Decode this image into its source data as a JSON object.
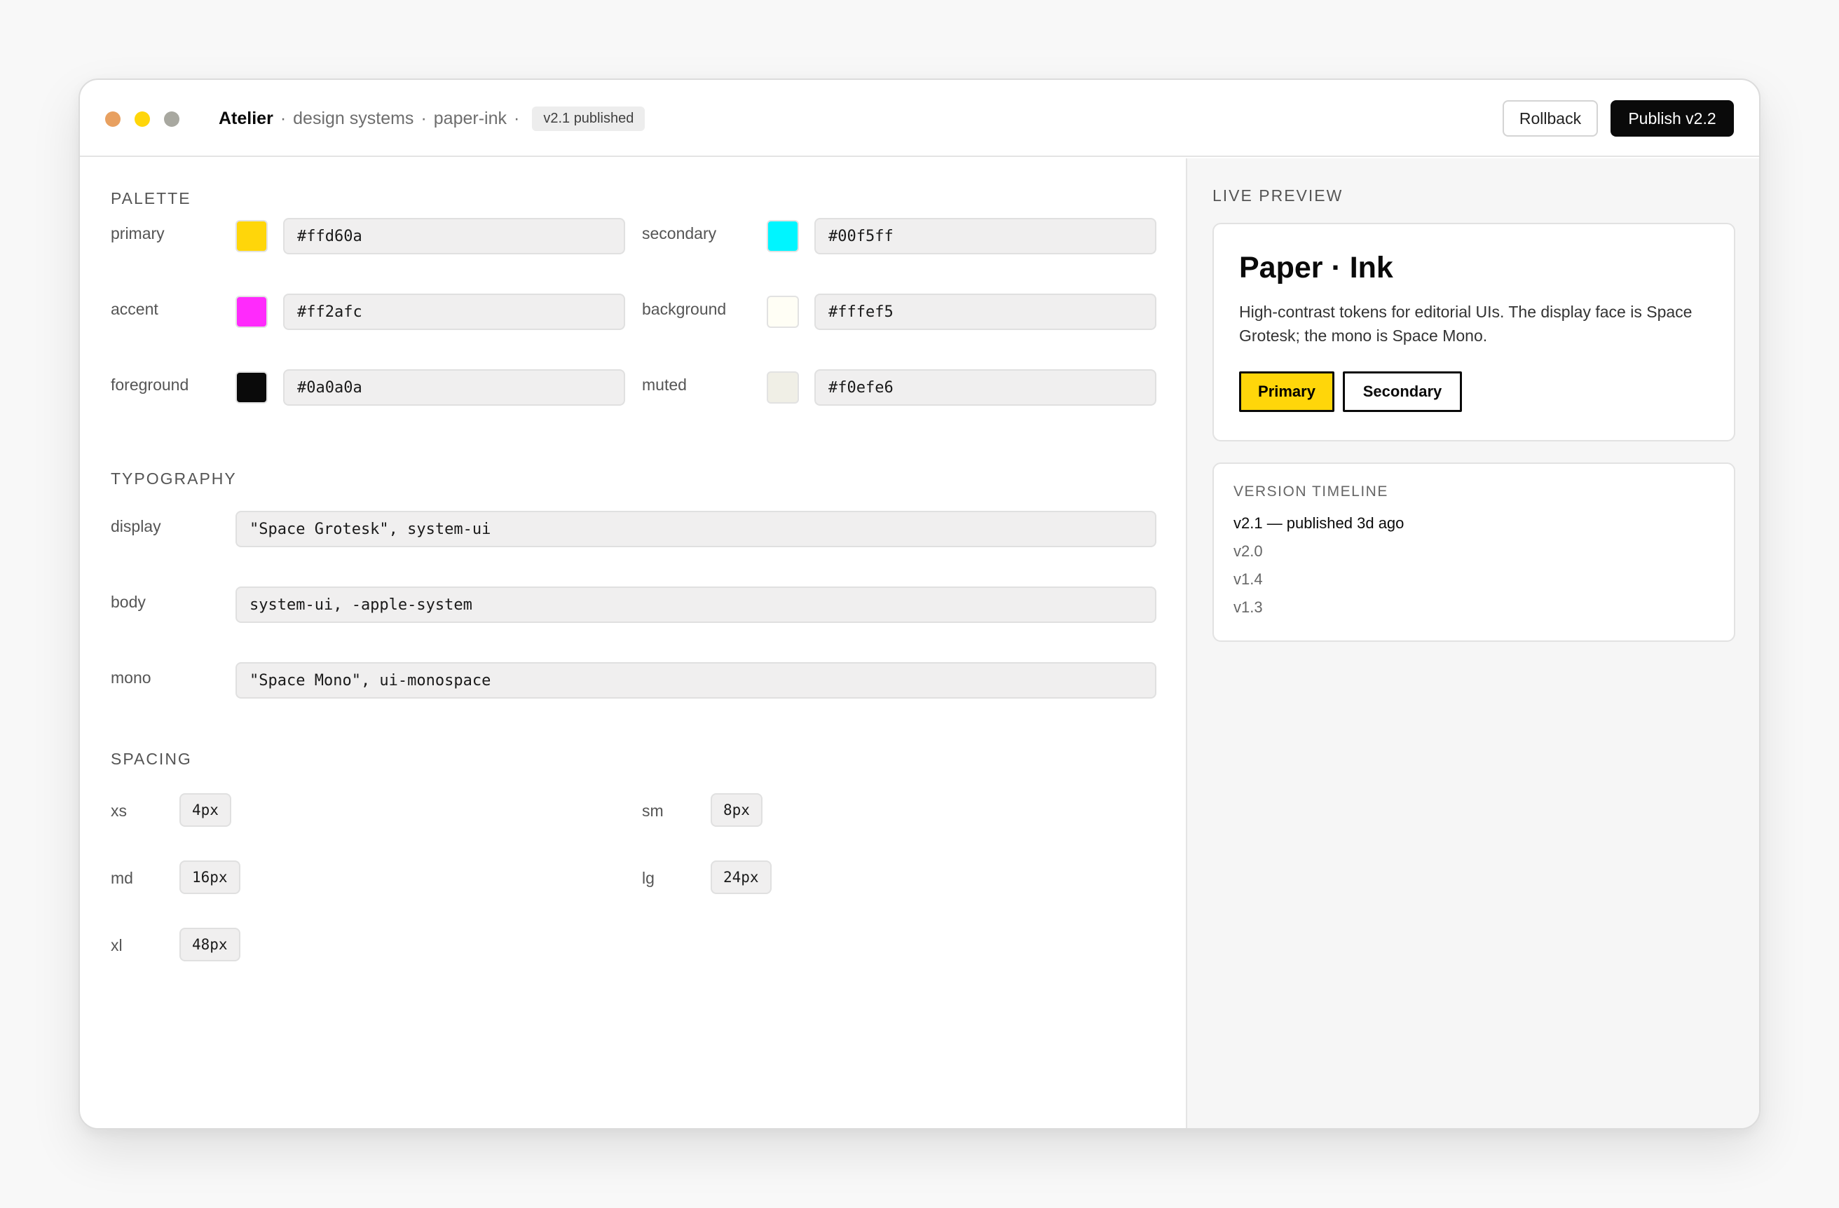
{
  "window": {
    "dots": [
      "#e8a060",
      "#ffd60a",
      "#a8a8a0"
    ],
    "breadcrumb": {
      "app": "Atelier",
      "sep": "·",
      "section": "design systems",
      "item": "paper-ink",
      "badge": "v2.1 published"
    },
    "actions": {
      "rollback": "Rollback",
      "publish": "Publish v2.2"
    }
  },
  "palette": {
    "title": "PALETTE",
    "colors": [
      {
        "label": "primary",
        "value": "#ffd60a",
        "swatch": "#ffd60a"
      },
      {
        "label": "secondary",
        "value": "#00f5ff",
        "swatch": "#00f5ff"
      },
      {
        "label": "accent",
        "value": "#ff2afc",
        "swatch": "#ff2afc"
      },
      {
        "label": "background",
        "value": "#fffef5",
        "swatch": "#fffef5"
      },
      {
        "label": "foreground",
        "value": "#0a0a0a",
        "swatch": "#0a0a0a"
      },
      {
        "label": "muted",
        "value": "#f0efe6",
        "swatch": "#f0efe6"
      }
    ]
  },
  "typography": {
    "title": "TYPOGRAPHY",
    "fonts": [
      {
        "label": "display",
        "value": "\"Space Grotesk\", system-ui"
      },
      {
        "label": "body",
        "value": "system-ui, -apple-system"
      },
      {
        "label": "mono",
        "value": "\"Space Mono\", ui-monospace"
      }
    ]
  },
  "spacing": {
    "title": "SPACING",
    "items": [
      {
        "label": "xs",
        "value": "4px"
      },
      {
        "label": "sm",
        "value": "8px"
      },
      {
        "label": "md",
        "value": "16px"
      },
      {
        "label": "lg",
        "value": "24px"
      },
      {
        "label": "xl",
        "value": "48px"
      }
    ]
  },
  "preview": {
    "section_title": "LIVE PREVIEW",
    "title": "Paper · Ink",
    "description": "High-contrast tokens for editorial UIs. The display face is Space Grotesk; the mono is Space Mono.",
    "primary_label": "Primary",
    "secondary_label": "Secondary"
  },
  "timeline": {
    "title": "VERSION TIMELINE",
    "versions": [
      "v2.1 — published 3d ago",
      "v2.0",
      "v1.4",
      "v1.3"
    ]
  }
}
